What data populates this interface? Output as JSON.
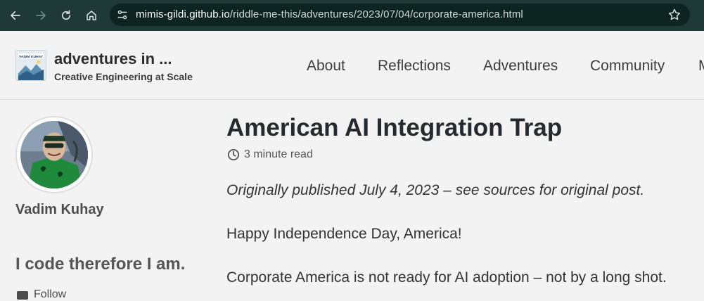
{
  "browser": {
    "url_host": "mimis-gildi.github.io",
    "url_path": "/riddle-me-this/adventures/2023/07/04/corporate-america.html",
    "icons": [
      "back-arrow-icon",
      "forward-arrow-icon",
      "reload-icon",
      "home-icon",
      "site-settings-icon",
      "bookmark-star-icon"
    ]
  },
  "site": {
    "title": "adventures in ...",
    "subtitle": "Creative Engineering at Scale",
    "logo_text": "VADIM KUHAY"
  },
  "nav": {
    "items": [
      "About",
      "Reflections",
      "Adventures",
      "Community",
      "M"
    ]
  },
  "author": {
    "name": "Vadim Kuhay",
    "bio": "I code therefore I am.",
    "follow_label": "Follow"
  },
  "post": {
    "title": "American AI Integration Trap",
    "read_time": "3 minute read",
    "paragraphs": [
      "Originally published July 4, 2023 – see sources for original post.",
      "Happy Independence Day, America!",
      "Corporate America is not ready for AI adoption – not by a long shot."
    ]
  },
  "colors": {
    "chrome_bg": "#1f3a36",
    "urlbar_bg": "#0e2420",
    "page_bg": "#f3f3f3",
    "title_text": "#262a2e"
  }
}
